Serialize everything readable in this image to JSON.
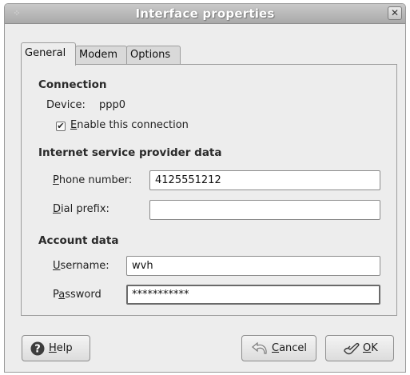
{
  "window": {
    "title": "Interface properties"
  },
  "tabs": [
    {
      "label": "General",
      "active": true
    },
    {
      "label": "Modem",
      "active": false
    },
    {
      "label": "Options",
      "active": false
    }
  ],
  "connection": {
    "heading": "Connection",
    "device_label": "Device:",
    "device_value": "ppp0",
    "enable_label_mnemonic": "E",
    "enable_label_rest": "nable this connection",
    "enable_checked": true
  },
  "isp": {
    "heading": "Internet service provider data",
    "phone_label_mnemonic": "P",
    "phone_label_rest": "hone number:",
    "phone_value": "4125551212",
    "dial_label_mnemonic": "D",
    "dial_label_rest": "ial prefix:",
    "dial_value": ""
  },
  "account": {
    "heading": "Account data",
    "username_label_mnemonic": "U",
    "username_label_rest": "sername:",
    "username_value": "wvh",
    "password_label_pre": "P",
    "password_label_mnemonic": "a",
    "password_label_rest": "ssword",
    "password_value": "***********"
  },
  "buttons": {
    "help_mnemonic": "H",
    "help_rest": "elp",
    "cancel_mnemonic": "C",
    "cancel_rest": "ancel",
    "ok_mnemonic": "O",
    "ok_rest": "K"
  }
}
